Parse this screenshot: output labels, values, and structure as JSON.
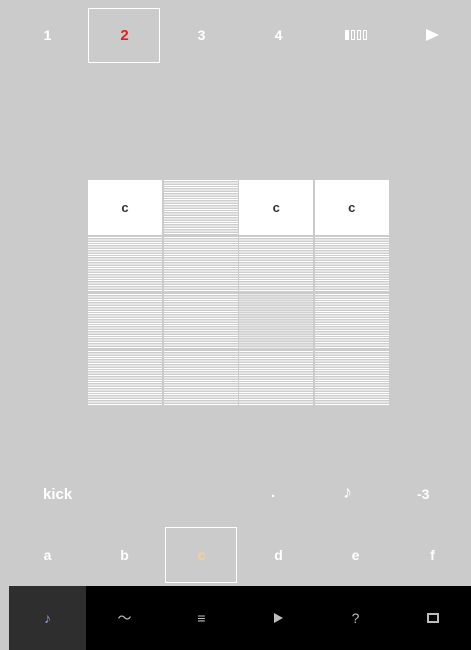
{
  "top_tabs": [
    {
      "label": "1",
      "selected": false
    },
    {
      "label": "2",
      "selected": true
    },
    {
      "label": "3",
      "selected": false
    },
    {
      "label": "4",
      "selected": false
    }
  ],
  "top_icons": [
    "pattern-bars-icon",
    "play-icon"
  ],
  "grid": {
    "rows": [
      [
        {
          "note": "c",
          "active": true
        },
        {
          "note": "",
          "active": false
        },
        {
          "note": "c",
          "active": true
        },
        {
          "note": "c",
          "active": true
        }
      ],
      [
        {
          "note": "",
          "active": false
        },
        {
          "note": "",
          "active": false
        },
        {
          "note": "",
          "active": false
        },
        {
          "note": "",
          "active": false
        }
      ],
      [
        {
          "note": "",
          "active": false
        },
        {
          "note": "",
          "active": false
        },
        {
          "note": "",
          "active": false,
          "dim": true
        },
        {
          "note": "",
          "active": false
        }
      ],
      [
        {
          "note": "",
          "active": false
        },
        {
          "note": "",
          "active": false
        },
        {
          "note": "",
          "active": false
        },
        {
          "note": "",
          "active": false
        }
      ]
    ]
  },
  "info": {
    "instrument": "kick",
    "dot": ".",
    "note_glyph": "♪",
    "value": "-3"
  },
  "letters": [
    {
      "label": "a",
      "selected": false
    },
    {
      "label": "b",
      "selected": false
    },
    {
      "label": "c",
      "selected": true
    },
    {
      "label": "d",
      "selected": false
    },
    {
      "label": "e",
      "selected": false
    },
    {
      "label": "f",
      "selected": false
    }
  ],
  "nav": [
    {
      "icon": "note-icon",
      "glyph": "♪",
      "active": true
    },
    {
      "icon": "wave-icon",
      "glyph": "〜",
      "active": false
    },
    {
      "icon": "menu-icon",
      "glyph": "≡",
      "active": false
    },
    {
      "icon": "play-icon",
      "glyph": "",
      "active": false
    },
    {
      "icon": "help-icon",
      "glyph": "?",
      "active": false
    },
    {
      "icon": "window-icon",
      "glyph": "",
      "active": false
    }
  ],
  "colors": {
    "background": "#cbcbcb",
    "selected_tab_text": "#e0231f",
    "selected_letter_text": "#f7d28a",
    "nav_active_icon": "#7f9df5",
    "nav_background": "#000000"
  }
}
